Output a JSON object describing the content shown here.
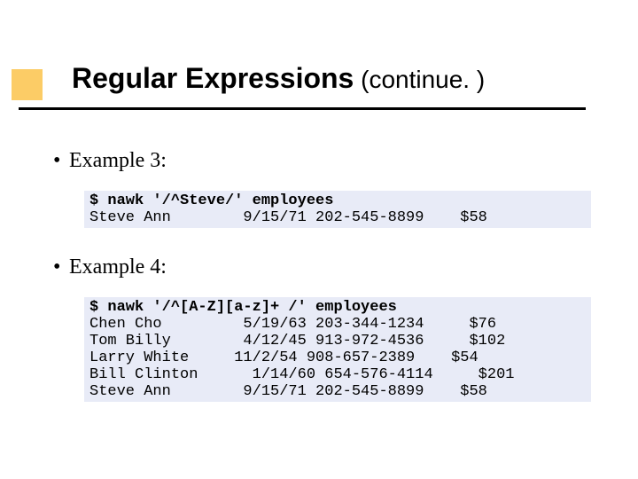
{
  "title": {
    "main": "Regular Expressions",
    "sub": " (continue. )"
  },
  "bullets": {
    "ex3": "Example 3:",
    "ex4": "Example 4:"
  },
  "code1": {
    "cmd": "$ nawk '/^Steve/' employees",
    "out": "Steve Ann        9/15/71 202-545-8899    $58"
  },
  "code2": {
    "cmd": "$ nawk '/^[A-Z][a-z]+ /' employees",
    "out": "Chen Cho         5/19/63 203-344-1234     $76\nTom Billy        4/12/45 913-972-4536     $102\nLarry White     11/2/54 908-657-2389    $54\nBill Clinton      1/14/60 654-576-4114     $201\nSteve Ann        9/15/71 202-545-8899    $58"
  }
}
